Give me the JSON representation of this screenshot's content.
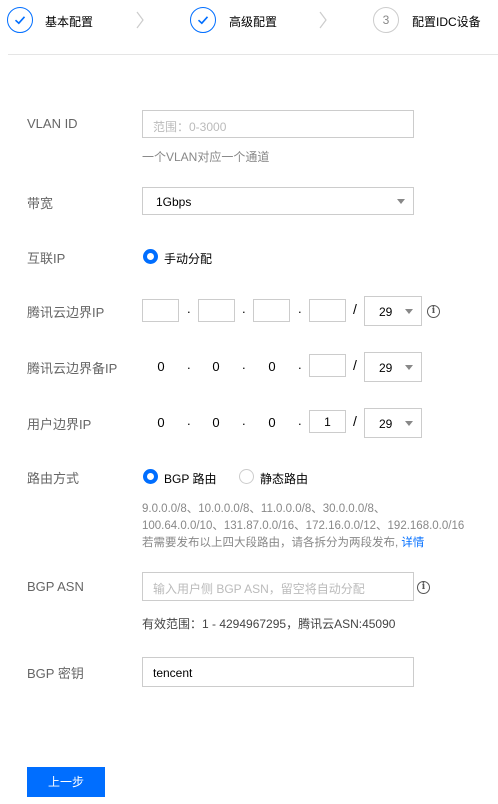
{
  "steps": [
    {
      "label": "基本配置",
      "status": "done"
    },
    {
      "label": "高级配置",
      "status": "done"
    },
    {
      "label": "配置IDC设备",
      "status": "pending",
      "number": "3"
    }
  ],
  "form": {
    "vlan": {
      "label": "VLAN ID",
      "placeholder": "范围：0-3000",
      "hint": "一个VLAN对应一个通道"
    },
    "bandwidth": {
      "label": "带宽",
      "value": "1Gbps"
    },
    "interconnect_ip": {
      "label": "互联IP",
      "option": "手动分配"
    },
    "tencent_edge_ip": {
      "label": "腾讯云边界IP",
      "octets": [
        "",
        "",
        "",
        ""
      ],
      "mask": "29"
    },
    "tencent_backup_ip": {
      "label": "腾讯云边界备IP",
      "octets": [
        "0",
        "0",
        "0",
        ""
      ],
      "mask": "29"
    },
    "user_edge_ip": {
      "label": "用户边界IP",
      "octets": [
        "0",
        "0",
        "0",
        "1"
      ],
      "mask": "29"
    },
    "routing": {
      "label": "路由方式",
      "options": [
        "BGP 路由",
        "静态路由"
      ],
      "selected": "BGP 路由",
      "routes_line1": "9.0.0.0/8、10.0.0.0/8、11.0.0.0/8、30.0.0.0/8、",
      "routes_line2": "100.64.0.0/10、131.87.0.0/16、172.16.0.0/12、192.168.0.0/16",
      "routes_line3": "若需要发布以上四大段路由，请各拆分为两段发布,",
      "details_link": "详情"
    },
    "bgp_asn": {
      "label": "BGP ASN",
      "placeholder": "输入用户侧 BGP ASN，留空将自动分配",
      "hint": "有效范围：1 - 4294967295，腾讯云ASN:45090"
    },
    "bgp_key": {
      "label": "BGP 密钥",
      "value": "tencent"
    }
  },
  "actions": {
    "prev_label": "上一步"
  },
  "colors": {
    "accent": "#006eff",
    "border": "#cccccc",
    "label": "#666666",
    "hint": "#888888"
  }
}
